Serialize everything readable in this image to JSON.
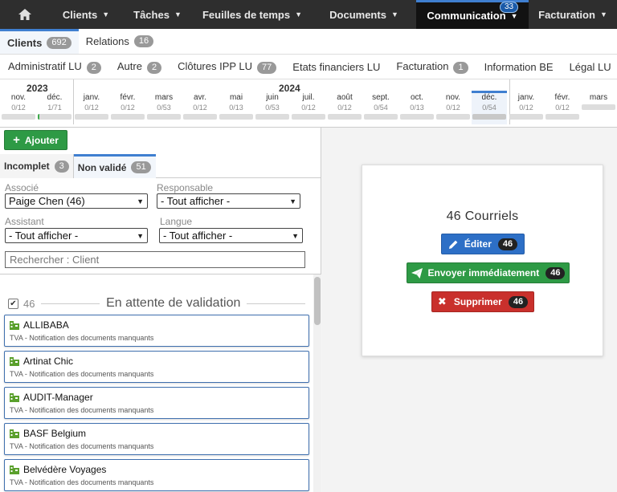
{
  "topnav": {
    "items": [
      {
        "label": "Clients"
      },
      {
        "label": "Tâches"
      },
      {
        "label": "Feuilles de temps"
      },
      {
        "label": "Documents"
      },
      {
        "label": "Communication",
        "badge": "33"
      },
      {
        "label": "Facturation"
      }
    ]
  },
  "tabs1": [
    {
      "label": "Clients",
      "count": "692"
    },
    {
      "label": "Relations",
      "count": "16"
    }
  ],
  "tabs2": [
    {
      "label": "Administratif LU",
      "count": "2"
    },
    {
      "label": "Autre",
      "count": "2"
    },
    {
      "label": "Clôtures IPP LU",
      "count": "77"
    },
    {
      "label": "Etats financiers LU"
    },
    {
      "label": "Facturation",
      "count": "1"
    },
    {
      "label": "Information BE"
    },
    {
      "label": "Légal LU"
    }
  ],
  "timeline": {
    "years": [
      "2023",
      "2024"
    ],
    "months": [
      {
        "m": "nov.",
        "f": "0/12"
      },
      {
        "m": "déc.",
        "f": "1/71"
      },
      {
        "m": "janv.",
        "f": "0/12"
      },
      {
        "m": "févr.",
        "f": "0/12"
      },
      {
        "m": "mars",
        "f": "0/53"
      },
      {
        "m": "avr.",
        "f": "0/12"
      },
      {
        "m": "mai",
        "f": "0/13"
      },
      {
        "m": "juin",
        "f": "0/53"
      },
      {
        "m": "juil.",
        "f": "0/12"
      },
      {
        "m": "août",
        "f": "0/12"
      },
      {
        "m": "sept.",
        "f": "0/54"
      },
      {
        "m": "oct.",
        "f": "0/13"
      },
      {
        "m": "nov.",
        "f": "0/12"
      },
      {
        "m": "déc.",
        "f": "0/54"
      },
      {
        "m": "janv.",
        "f": "0/12"
      },
      {
        "m": "févr.",
        "f": "0/12"
      },
      {
        "m": "mars",
        "f": ""
      }
    ]
  },
  "left": {
    "add_label": "Ajouter",
    "subtabs": [
      {
        "label": "Incomplet",
        "count": "3"
      },
      {
        "label": "Non validé",
        "count": "51"
      }
    ],
    "filters": {
      "associe_label": "Associé",
      "associe_value": "Paige Chen (46)",
      "responsable_label": "Responsable",
      "responsable_value": "- Tout afficher -",
      "assistant_label": "Assistant",
      "assistant_value": "- Tout afficher -",
      "langue_label": "Langue",
      "langue_value": "- Tout afficher -"
    },
    "search_placeholder": "Rechercher : Client",
    "group": {
      "count": "46",
      "title": "En attente de validation"
    },
    "items": [
      {
        "name": "ALLIBABA",
        "sub": "TVA - Notification des documents manquants"
      },
      {
        "name": "Artinat Chic",
        "sub": "TVA - Notification des documents manquants"
      },
      {
        "name": "AUDIT-Manager",
        "sub": "TVA - Notification des documents manquants"
      },
      {
        "name": "BASF Belgium",
        "sub": "TVA - Notification des documents manquants"
      },
      {
        "name": "Belvédère Voyages",
        "sub": "TVA - Notification des documents manquants"
      }
    ]
  },
  "right": {
    "title": "46 Courriels",
    "edit_label": "Éditer",
    "edit_count": "46",
    "send_label": "Envoyer immédiatement",
    "send_count": "46",
    "delete_label": "Supprimer",
    "delete_count": "46"
  }
}
